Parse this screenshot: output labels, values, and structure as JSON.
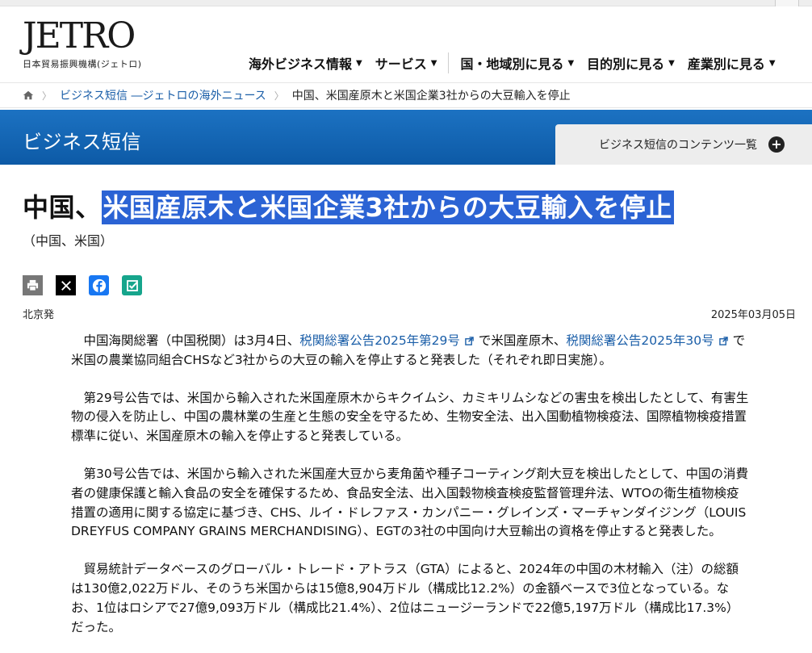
{
  "brand": {
    "logo_text": "JETRO",
    "logo_sub": "日本貿易振興機構(ジェトロ)"
  },
  "nav": {
    "items": [
      {
        "label": "海外ビジネス情報"
      },
      {
        "label": "サービス"
      },
      {
        "label": "国・地域別に見る"
      },
      {
        "label": "目的別に見る"
      },
      {
        "label": "産業別に見る"
      }
    ]
  },
  "breadcrumb": {
    "link": "ビジネス短信 ―ジェトロの海外ニュース",
    "current": "中国、米国産原木と米国企業3社からの大豆輸入を停止"
  },
  "banner": {
    "title": "ビジネス短信",
    "tab_label": "ビジネス短信のコンテンツ一覧"
  },
  "article": {
    "title_prefix": "中国、",
    "title_selected": "米国産原木と米国企業3社からの大豆輸入を停止",
    "region": "（中国、米国）",
    "location": "北京発",
    "date": "2025年03月05日",
    "p1": {
      "t1": "中国海関総署（中国税関）は3月4日、",
      "link1": "税関総署公告2025年第29号",
      "t2": "で米国産原木、",
      "link2": "税関総署公告2025年30号",
      "t3": "で米国の農業協同組合CHSなど3社からの大豆の輸入を停止すると発表した（それぞれ即日実施）。"
    },
    "p2": "第29号公告では、米国から輸入された米国産原木からキクイムシ、カミキリムシなどの害虫を検出したとして、有害生物の侵入を防止し、中国の農林業の生産と生態の安全を守るため、生物安全法、出入国動植物検疫法、国際植物検疫措置標準に従い、米国産原木の輸入を停止すると発表している。",
    "p3": "第30号公告では、米国から輸入された米国産大豆から麦角菌や種子コーティング剤大豆を検出したとして、中国の消費者の健康保護と輸入食品の安全を確保するため、食品安全法、出入国穀物検査検疫監督管理弁法、WTOの衛生植物検疫措置の適用に関する協定に基づき、CHS、ルイ・ドレファス・カンパニー・グレインズ・マーチャンダイジング（LOUIS DREYFUS COMPANY GRAINS MERCHANDISING）、EGTの3社の中国向け大豆輸出の資格を停止すると発表した。",
    "p4": "貿易統計データベースのグローバル・トレード・アトラス（GTA）によると、2024年の中国の木材輸入（注）の総額は130億2,022万ドル、そのうち米国からは15億8,904万ドル（構成比12.2%）の金額ベースで3位となっている。なお、1位はロシアで27億9,093万ドル（構成比21.4%）、2位はニュージーランドで22億5,197万ドル（構成比17.3%）だった。"
  },
  "icons": {
    "home": "home-icon",
    "print": "print-icon",
    "x": "x-icon",
    "facebook": "facebook-icon",
    "bookmark": "check-icon",
    "external": "external-link-icon",
    "plus": "plus-circle-icon"
  },
  "colors": {
    "banner": "#0d5aa6",
    "link": "#1a5ea8",
    "selection": "#2b63d4"
  }
}
